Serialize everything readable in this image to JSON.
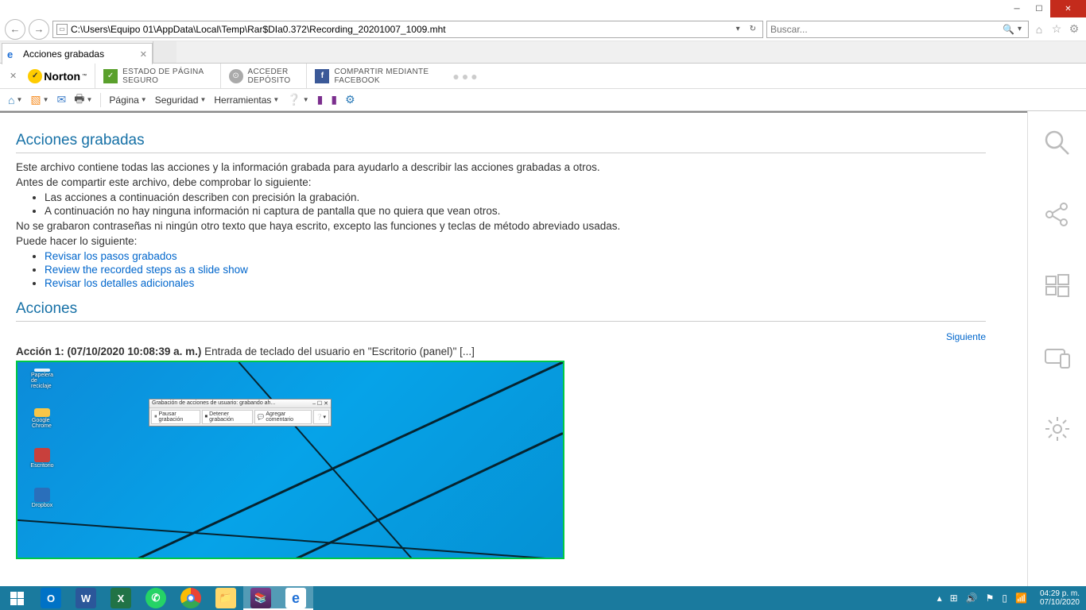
{
  "window": {
    "minimize": "",
    "maximize": "",
    "close": ""
  },
  "nav": {
    "url": "C:\\Users\\Equipo 01\\AppData\\Local\\Temp\\Rar$DIa0.372\\Recording_20201007_1009.mht",
    "search_placeholder": "Buscar..."
  },
  "tab": {
    "title": "Acciones grabadas"
  },
  "norton": {
    "brand": "Norton",
    "page_status_top": "ESTADO DE PÁGINA",
    "page_status_bottom": "SEGURO",
    "vault_top": "ACCEDER",
    "vault_bottom": "DEPÓSITO",
    "share_top": "COMPARTIR MEDIANTE",
    "share_bottom": "FACEBOOK"
  },
  "cmd": {
    "page": "Página",
    "security": "Seguridad",
    "tools": "Herramientas"
  },
  "doc": {
    "h1": "Acciones grabadas",
    "p1": "Este archivo contiene todas las acciones y la información grabada para ayudarlo a describir las acciones grabadas a otros.",
    "p2": "Antes de compartir este archivo, debe comprobar lo siguiente:",
    "b1": "Las acciones a continuación describen con precisión la grabación.",
    "b2": "A continuación no hay ninguna información ni captura de pantalla que no quiera que vean otros.",
    "p3": "No se grabaron contraseñas ni ningún otro texto que haya escrito, excepto las funciones y teclas de método abreviado usadas.",
    "p4": "Puede hacer lo siguiente:",
    "l1": "Revisar los pasos grabados",
    "l2": "Review the recorded steps as a slide show",
    "l3": "Revisar los detalles adicionales",
    "h2": "Acciones",
    "next": "Siguiente",
    "action1_bold": "Acción 1: (07/10/2020 10:08:39 a. m.) ",
    "action1_rest": "Entrada de teclado del usuario en \"Escritorio (panel)\" [...]"
  },
  "shot": {
    "recycle": "Papelera de reciclaje",
    "chrome": "Google Chrome",
    "excel": "Escritorio",
    "dropbox": "Dropbox",
    "rec_title": "Grabación de acciones de usuario: grabando ah...",
    "rec_pause": "Pausar grabación",
    "rec_stop": "Detener grabación",
    "rec_comment": "Agregar comentario"
  },
  "clock": {
    "time": "04:29 p. m.",
    "date": "07/10/2020"
  }
}
